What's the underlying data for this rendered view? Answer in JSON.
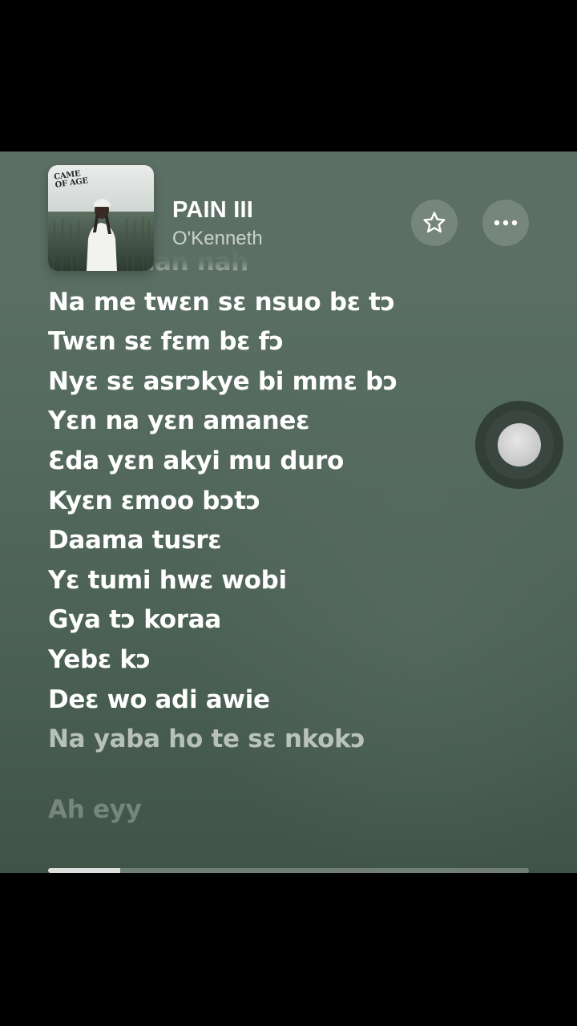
{
  "track": {
    "title": "PAIN III",
    "artist": "O'Kenneth",
    "artwork_text": "CAME OF AGE"
  },
  "lyrics": {
    "partial_top": "O nan nan nah",
    "lines": [
      "Na me twɛn sɛ nsuo bɛ tɔ",
      "Twɛn sɛ fɛm bɛ fɔ",
      "Nyɛ sɛ asrɔkye bi mmɛ bɔ",
      "Yɛn na yɛn amaneɛ",
      "Ɛda yɛn akyi mu duro",
      "Kyɛn ɛmoo bɔtɔ",
      "Daama tusrɛ",
      "Yɛ tumi hwɛ wobi",
      "Gya tɔ koraa",
      "Yebɛ kɔ",
      "Deɛ wo adi awie"
    ],
    "upcoming": "Na yaba ho te sɛ nkokɔ",
    "next_section": "Ah eyy"
  },
  "icons": {
    "favorite": "star-icon",
    "more": "ellipsis-icon",
    "assistive_touch": "assistive-touch-icon"
  },
  "playback": {
    "progress": 0.15
  },
  "colors": {
    "background": "#566b60",
    "text": "#ffffff"
  }
}
